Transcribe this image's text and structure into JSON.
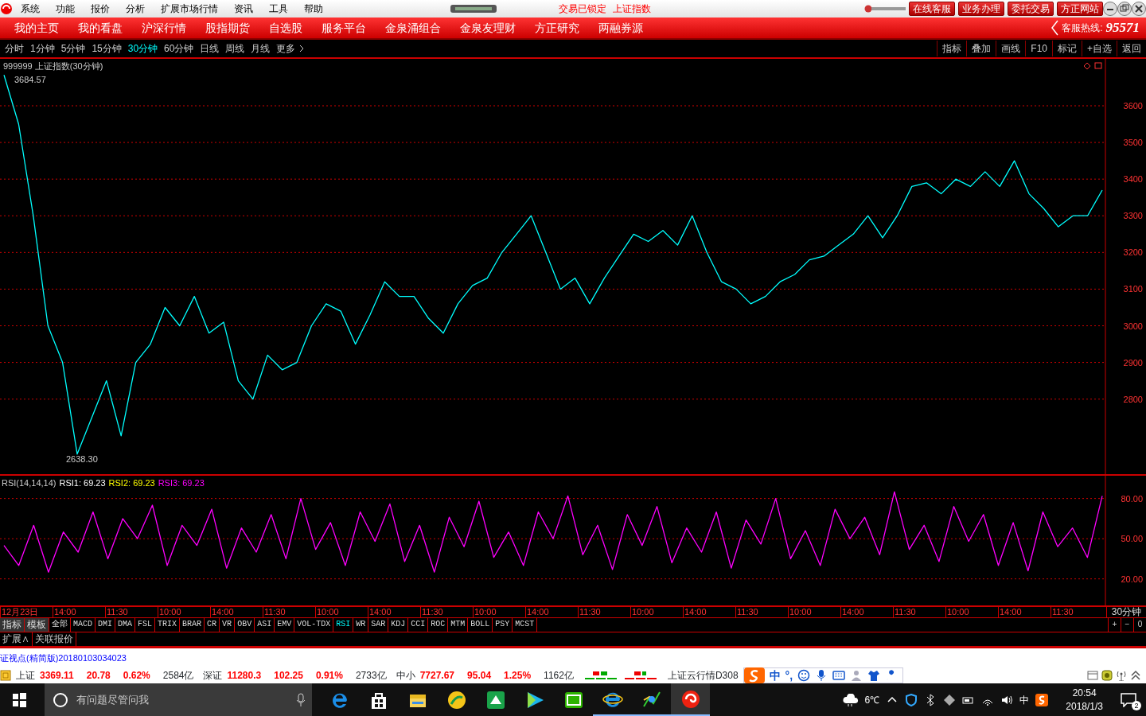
{
  "menu": [
    "系统",
    "功能",
    "报价",
    "分析",
    "扩展市场行情",
    "资讯",
    "工具",
    "帮助"
  ],
  "title_status": [
    "交易已锁定",
    "上证指数"
  ],
  "top_buttons": [
    "在线客服",
    "业务办理",
    "委托交易",
    "方正网站"
  ],
  "nav": [
    "我的主页",
    "我的看盘",
    "沪深行情",
    "股指期货",
    "自选股",
    "服务平台",
    "金泉涌组合",
    "金泉友理财",
    "方正研究",
    "两融券源"
  ],
  "hotline": {
    "label": "客服热线:",
    "number": "95571"
  },
  "periods": [
    {
      "label": "分时",
      "selected": false
    },
    {
      "label": "1分钟",
      "selected": false
    },
    {
      "label": "5分钟",
      "selected": false
    },
    {
      "label": "15分钟",
      "selected": false
    },
    {
      "label": "30分钟",
      "selected": true
    },
    {
      "label": "60分钟",
      "selected": false
    },
    {
      "label": "日线",
      "selected": false
    },
    {
      "label": "周线",
      "selected": false
    },
    {
      "label": "月线",
      "selected": false
    }
  ],
  "more": "更多",
  "tools": [
    "指标",
    "叠加",
    "画线",
    "F10",
    "标记",
    "+自选",
    "返回"
  ],
  "chart": {
    "title": "999999 上证指数(30分钟)",
    "high_label": "3684.57",
    "low_label": "2638.30",
    "chart_data": {
      "type": "line",
      "grid": true,
      "ylim": [
        2591,
        3728
      ],
      "yticks": [
        2800,
        2900,
        3000,
        3100,
        3200,
        3300,
        3400,
        3500,
        3600
      ],
      "series": [
        {
          "color": "#00ffff",
          "values": [
            3684,
            3550,
            3300,
            3000,
            2900,
            2650,
            2750,
            2850,
            2700,
            2900,
            2950,
            3050,
            3000,
            3080,
            2980,
            3010,
            2850,
            2800,
            2920,
            2880,
            2900,
            3000,
            3060,
            3040,
            2950,
            3030,
            3120,
            3080,
            3080,
            3020,
            2980,
            3060,
            3110,
            3130,
            3200,
            3250,
            3300,
            3200,
            3100,
            3130,
            3060,
            3130,
            3190,
            3250,
            3230,
            3260,
            3220,
            3300,
            3200,
            3120,
            3100,
            3060,
            3080,
            3120,
            3140,
            3180,
            3190,
            3220,
            3250,
            3300,
            3240,
            3300,
            3380,
            3390,
            3360,
            3400,
            3380,
            3420,
            3380,
            3450,
            3360,
            3320,
            3270,
            3300,
            3300,
            3370
          ]
        }
      ]
    }
  },
  "rsi": {
    "label": "RSI(14,14,14)",
    "items": [
      {
        "name": "RSI1:",
        "value": "69.23",
        "color": "#ffffff"
      },
      {
        "name": "RSI2:",
        "value": "69.23",
        "color": "#ffff00"
      },
      {
        "name": "RSI3:",
        "value": "69.23",
        "color": "#ff00ff"
      }
    ],
    "chart_data": {
      "type": "line",
      "grid": true,
      "ylim": [
        -1,
        97
      ],
      "yticks": [
        {
          "value": 20,
          "label": "20.00"
        },
        {
          "value": 50,
          "label": "50.00"
        },
        {
          "value": 80,
          "label": "80.00"
        }
      ],
      "series": [
        {
          "color": "#ff00ff",
          "values": [
            45,
            30,
            60,
            25,
            55,
            40,
            70,
            35,
            65,
            50,
            75,
            30,
            60,
            45,
            72,
            28,
            58,
            40,
            68,
            35,
            80,
            42,
            62,
            30,
            70,
            48,
            76,
            33,
            60,
            25,
            66,
            44,
            78,
            36,
            55,
            30,
            70,
            50,
            82,
            38,
            60,
            27,
            68,
            45,
            74,
            32,
            58,
            40,
            70,
            28,
            64,
            46,
            80,
            35,
            56,
            30,
            72,
            50,
            66,
            38,
            85,
            42,
            60,
            33,
            74,
            48,
            68,
            30,
            62,
            26,
            70,
            44,
            58,
            36,
            82
          ]
        }
      ]
    }
  },
  "time_axis": [
    "12月23日",
    "14:00",
    "11:30",
    "10:00",
    "14:00",
    "11:30",
    "10:00",
    "14:00",
    "11:30",
    "10:00",
    "14:00",
    "11:30",
    "10:00",
    "14:00",
    "11:30",
    "10:00",
    "14:00",
    "11:30",
    "10:00",
    "14:00",
    "11:30"
  ],
  "period_label": "30分钟",
  "indicator_tabs": [
    {
      "label": "指标",
      "kind": "menu",
      "selected": false
    },
    {
      "label": "模板",
      "kind": "menu",
      "selected": false
    },
    {
      "label": "全部",
      "kind": "indicator",
      "selected": false
    },
    {
      "label": "MACD",
      "kind": "indicator",
      "selected": false
    },
    {
      "label": "DMI",
      "kind": "indicator",
      "selected": false
    },
    {
      "label": "DMA",
      "kind": "indicator",
      "selected": false
    },
    {
      "label": "FSL",
      "kind": "indicator",
      "selected": false
    },
    {
      "label": "TRIX",
      "kind": "indicator",
      "selected": false
    },
    {
      "label": "BRAR",
      "kind": "indicator",
      "selected": false
    },
    {
      "label": "CR",
      "kind": "indicator",
      "selected": false
    },
    {
      "label": "VR",
      "kind": "indicator",
      "selected": false
    },
    {
      "label": "OBV",
      "kind": "indicator",
      "selected": false
    },
    {
      "label": "ASI",
      "kind": "indicator",
      "selected": false
    },
    {
      "label": "EMV",
      "kind": "indicator",
      "selected": false
    },
    {
      "label": "VOL-TDX",
      "kind": "indicator",
      "selected": false
    },
    {
      "label": "RSI",
      "kind": "indicator",
      "selected": true
    },
    {
      "label": "WR",
      "kind": "indicator",
      "selected": false
    },
    {
      "label": "SAR",
      "kind": "indicator",
      "selected": false
    },
    {
      "label": "KDJ",
      "kind": "indicator",
      "selected": false
    },
    {
      "label": "CCI",
      "kind": "indicator",
      "selected": false
    },
    {
      "label": "ROC",
      "kind": "indicator",
      "selected": false
    },
    {
      "label": "MTM",
      "kind": "indicator",
      "selected": false
    },
    {
      "label": "BOLL",
      "kind": "indicator",
      "selected": false
    },
    {
      "label": "PSY",
      "kind": "indicator",
      "selected": false
    },
    {
      "label": "MCST",
      "kind": "indicator",
      "selected": false
    }
  ],
  "zoom_buttons": [
    "+",
    "−",
    "0"
  ],
  "ext_buttons": [
    "扩展∧",
    "关联报价"
  ],
  "ticker": "证视点(精简版)20180103034023",
  "indices": [
    {
      "name": "上证",
      "price": "3369.11",
      "change": "20.78",
      "pct": "0.62%",
      "amount": "2584亿"
    },
    {
      "name": "深证",
      "price": "11280.3",
      "change": "102.25",
      "pct": "0.91%",
      "amount": "2733亿"
    },
    {
      "name": "中小",
      "price": "7727.67",
      "change": "95.04",
      "pct": "1.25%",
      "amount": "1162亿"
    }
  ],
  "cloud_label": "上证云行情D308",
  "ime": [
    "中",
    "°,"
  ],
  "taskbar": {
    "search_placeholder": "有问题尽管问我",
    "weather": "6℃",
    "ime": "中",
    "time": "20:54",
    "date": "2018/1/3",
    "notifications": "2"
  }
}
